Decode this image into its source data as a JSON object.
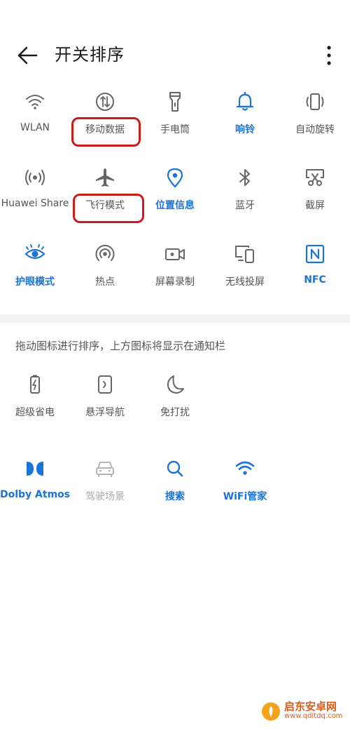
{
  "header": {
    "title": "开关排序",
    "back_icon": "arrow-left-icon",
    "more_icon": "more-vertical-icon"
  },
  "colors": {
    "accent": "#1a73d9",
    "highlight": "#cc1b1b",
    "text": "#555555"
  },
  "active_tiles": [
    {
      "label": "WLAN",
      "icon": "wifi-icon",
      "active": false
    },
    {
      "label": "移动数据",
      "icon": "mobile-data-icon",
      "active": false
    },
    {
      "label": "手电筒",
      "icon": "flashlight-icon",
      "active": false
    },
    {
      "label": "响铃",
      "icon": "bell-icon",
      "active": true
    },
    {
      "label": "自动旋转",
      "icon": "auto-rotate-icon",
      "active": false
    },
    {
      "label": "Huawei Share",
      "icon": "huawei-share-icon",
      "active": false
    },
    {
      "label": "飞行模式",
      "icon": "airplane-icon",
      "active": false
    },
    {
      "label": "位置信息",
      "icon": "location-icon",
      "active": true
    },
    {
      "label": "蓝牙",
      "icon": "bluetooth-icon",
      "active": false
    },
    {
      "label": "截屏",
      "icon": "screenshot-icon",
      "active": false
    },
    {
      "label": "护眼模式",
      "icon": "eye-icon",
      "active": true
    },
    {
      "label": "热点",
      "icon": "hotspot-icon",
      "active": false
    },
    {
      "label": "屏幕录制",
      "icon": "screen-record-icon",
      "active": false
    },
    {
      "label": "无线投屏",
      "icon": "wireless-projection-icon",
      "active": false
    },
    {
      "label": "NFC",
      "icon": "nfc-icon",
      "active": true
    }
  ],
  "hint_text": "拖动图标进行排序，上方图标将显示在通知栏",
  "inactive_tiles": [
    {
      "label": "超级省电",
      "icon": "battery-saver-icon"
    },
    {
      "label": "悬浮导航",
      "icon": "floating-nav-icon"
    },
    {
      "label": "免打扰",
      "icon": "moon-icon"
    },
    {
      "label": "Dolby Atmos",
      "icon": "dolby-icon",
      "style": "active"
    },
    {
      "label": "驾驶场景",
      "icon": "car-icon",
      "style": "dim"
    },
    {
      "label": "搜索",
      "icon": "search-icon",
      "style": "active"
    },
    {
      "label": "WiFi管家",
      "icon": "wifi-manager-icon",
      "style": "active"
    }
  ],
  "watermark": {
    "name": "启东安卓网",
    "url": "www.qdltdq.com"
  }
}
